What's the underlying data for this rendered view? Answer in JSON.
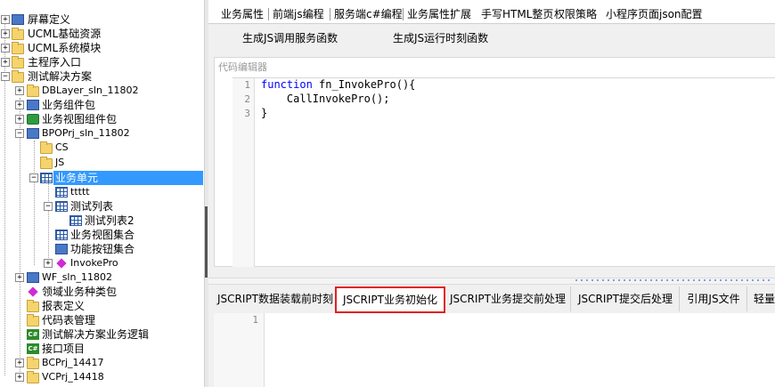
{
  "tree": {
    "items": [
      {
        "label": "屏幕定义"
      },
      {
        "label": "UCML基础资源"
      },
      {
        "label": "UCML系统模块"
      },
      {
        "label": "主程序入口"
      },
      {
        "label": "测试解决方案"
      },
      {
        "label": "DBLayer_sln_11802"
      },
      {
        "label": "业务组件包"
      },
      {
        "label": "业务视图组件包"
      },
      {
        "label": "BPOPrj_sln_11802"
      },
      {
        "label": "CS"
      },
      {
        "label": "JS"
      },
      {
        "label": "业务单元"
      },
      {
        "label": "ttttt"
      },
      {
        "label": "测试列表"
      },
      {
        "label": "测试列表2"
      },
      {
        "label": "业务视图集合"
      },
      {
        "label": "功能按钮集合"
      },
      {
        "label": "InvokePro"
      },
      {
        "label": "WF_sln_11802"
      },
      {
        "label": "领域业务种类包"
      },
      {
        "label": "报表定义"
      },
      {
        "label": "代码表管理"
      },
      {
        "label": "测试解决方案业务逻辑"
      },
      {
        "label": "接口项目"
      },
      {
        "label": "BCPrj_14417"
      },
      {
        "label": "VCPrj_14418"
      }
    ]
  },
  "top_tabs": [
    "业务属性",
    "前端js编程",
    "服务端c#编程",
    "业务属性扩展",
    "手写HTML整页",
    "权限策略",
    "小程序页面json配置"
  ],
  "toolbar": {
    "gen_js_service": "生成JS调用服务函数",
    "gen_js_runtime": "生成JS运行时刻函数"
  },
  "editor": {
    "title": "代码编辑器",
    "line_numbers": [
      "1",
      "2",
      "3"
    ],
    "lines": [
      {
        "kw": "function",
        "rest": " fn_InvokePro(){"
      },
      {
        "kw": "",
        "rest": "    CallInvokePro();"
      },
      {
        "kw": "",
        "rest": "}"
      }
    ]
  },
  "bottom_tabs": [
    "JSCRIPT数据装载前时刻",
    "JSCRIPT业务初始化",
    "JSCRIPT业务提交前处理",
    "JSCRIPT提交后处理",
    "引用JS文件",
    "轻量"
  ],
  "bottom_tab_active": "JSCRIPT业务初始化",
  "bottom_editor": {
    "line_numbers": [
      "1"
    ]
  },
  "colors": {
    "selection": "#3399ff",
    "keyword": "#0000ff",
    "active_tab_border": "#e02020"
  }
}
